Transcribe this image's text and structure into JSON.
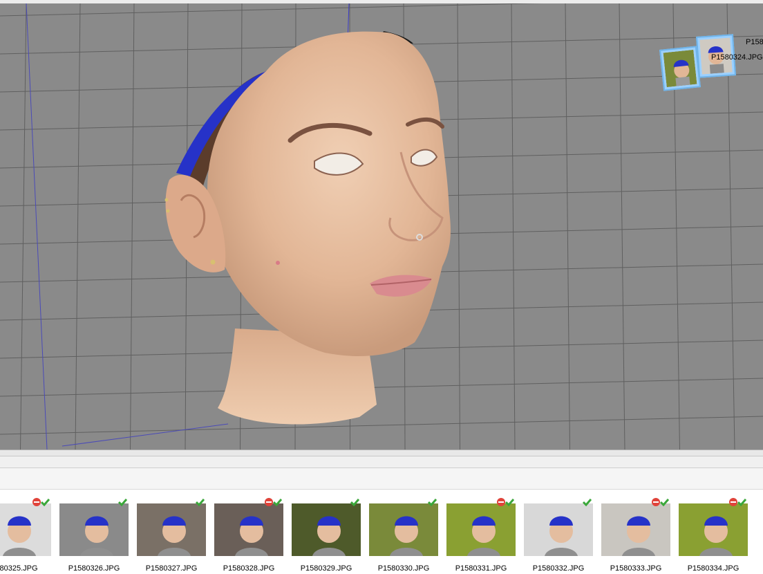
{
  "viewport": {
    "background_color": "#8a8a8a",
    "grid_color": "#5e5e5e",
    "axis_color": "#3c3cc8",
    "camera_labels": [
      {
        "text": "P158"
      },
      {
        "text": "P1580324.JPG"
      }
    ]
  },
  "filmstrip": {
    "thumbnails": [
      {
        "name": "580325.JPG",
        "status": [
          "disabled-icon",
          "check-icon"
        ],
        "bg": "#dcdcdc"
      },
      {
        "name": "P1580326.JPG",
        "status": [
          "check-icon"
        ],
        "bg": "#8a8a8a"
      },
      {
        "name": "P1580327.JPG",
        "status": [
          "check-icon"
        ],
        "bg": "#7a7066"
      },
      {
        "name": "P1580328.JPG",
        "status": [
          "disabled-icon",
          "check-icon"
        ],
        "bg": "#6a5f58"
      },
      {
        "name": "P1580329.JPG",
        "status": [
          "check-icon"
        ],
        "bg": "#4e5a2a"
      },
      {
        "name": "P1580330.JPG",
        "status": [
          "check-icon"
        ],
        "bg": "#7a8a3a"
      },
      {
        "name": "P1580331.JPG",
        "status": [
          "disabled-icon",
          "check-icon"
        ],
        "bg": "#8aa032"
      },
      {
        "name": "P1580332.JPG",
        "status": [
          "check-icon"
        ],
        "bg": "#d8d8d8"
      },
      {
        "name": "P1580333.JPG",
        "status": [
          "disabled-icon",
          "check-icon"
        ],
        "bg": "#c9c6c0"
      },
      {
        "name": "P1580334.JPG",
        "status": [
          "disabled-icon",
          "check-icon"
        ],
        "bg": "#8aa032"
      }
    ]
  },
  "colors": {
    "check": "#3aa73a",
    "disabled": "#e0433a",
    "headband": "#2632c8",
    "skin": "#e4bd9f"
  }
}
